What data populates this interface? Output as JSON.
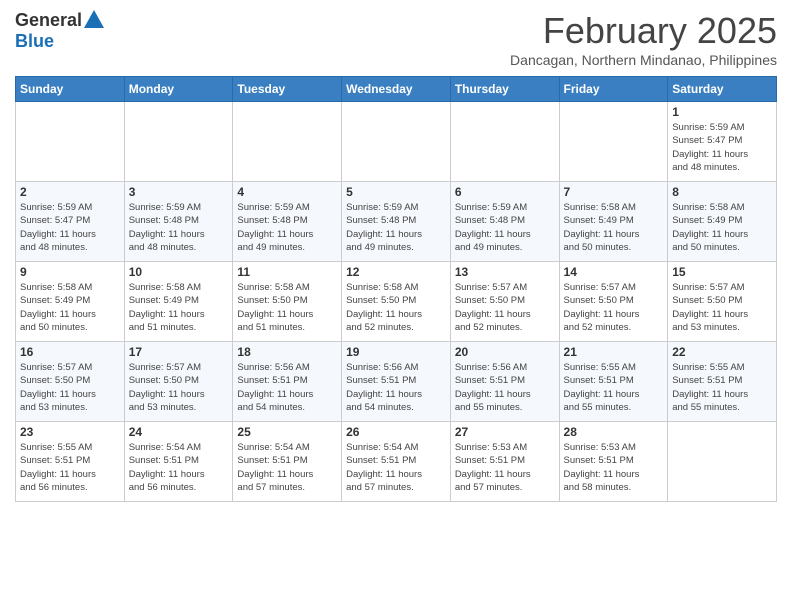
{
  "header": {
    "logo_general": "General",
    "logo_blue": "Blue",
    "month_year": "February 2025",
    "location": "Dancagan, Northern Mindanao, Philippines"
  },
  "calendar": {
    "days_of_week": [
      "Sunday",
      "Monday",
      "Tuesday",
      "Wednesday",
      "Thursday",
      "Friday",
      "Saturday"
    ],
    "weeks": [
      [
        {
          "day": "",
          "info": ""
        },
        {
          "day": "",
          "info": ""
        },
        {
          "day": "",
          "info": ""
        },
        {
          "day": "",
          "info": ""
        },
        {
          "day": "",
          "info": ""
        },
        {
          "day": "",
          "info": ""
        },
        {
          "day": "1",
          "info": "Sunrise: 5:59 AM\nSunset: 5:47 PM\nDaylight: 11 hours\nand 48 minutes."
        }
      ],
      [
        {
          "day": "2",
          "info": "Sunrise: 5:59 AM\nSunset: 5:47 PM\nDaylight: 11 hours\nand 48 minutes."
        },
        {
          "day": "3",
          "info": "Sunrise: 5:59 AM\nSunset: 5:48 PM\nDaylight: 11 hours\nand 48 minutes."
        },
        {
          "day": "4",
          "info": "Sunrise: 5:59 AM\nSunset: 5:48 PM\nDaylight: 11 hours\nand 49 minutes."
        },
        {
          "day": "5",
          "info": "Sunrise: 5:59 AM\nSunset: 5:48 PM\nDaylight: 11 hours\nand 49 minutes."
        },
        {
          "day": "6",
          "info": "Sunrise: 5:59 AM\nSunset: 5:48 PM\nDaylight: 11 hours\nand 49 minutes."
        },
        {
          "day": "7",
          "info": "Sunrise: 5:58 AM\nSunset: 5:49 PM\nDaylight: 11 hours\nand 50 minutes."
        },
        {
          "day": "8",
          "info": "Sunrise: 5:58 AM\nSunset: 5:49 PM\nDaylight: 11 hours\nand 50 minutes."
        }
      ],
      [
        {
          "day": "9",
          "info": "Sunrise: 5:58 AM\nSunset: 5:49 PM\nDaylight: 11 hours\nand 50 minutes."
        },
        {
          "day": "10",
          "info": "Sunrise: 5:58 AM\nSunset: 5:49 PM\nDaylight: 11 hours\nand 51 minutes."
        },
        {
          "day": "11",
          "info": "Sunrise: 5:58 AM\nSunset: 5:50 PM\nDaylight: 11 hours\nand 51 minutes."
        },
        {
          "day": "12",
          "info": "Sunrise: 5:58 AM\nSunset: 5:50 PM\nDaylight: 11 hours\nand 52 minutes."
        },
        {
          "day": "13",
          "info": "Sunrise: 5:57 AM\nSunset: 5:50 PM\nDaylight: 11 hours\nand 52 minutes."
        },
        {
          "day": "14",
          "info": "Sunrise: 5:57 AM\nSunset: 5:50 PM\nDaylight: 11 hours\nand 52 minutes."
        },
        {
          "day": "15",
          "info": "Sunrise: 5:57 AM\nSunset: 5:50 PM\nDaylight: 11 hours\nand 53 minutes."
        }
      ],
      [
        {
          "day": "16",
          "info": "Sunrise: 5:57 AM\nSunset: 5:50 PM\nDaylight: 11 hours\nand 53 minutes."
        },
        {
          "day": "17",
          "info": "Sunrise: 5:57 AM\nSunset: 5:50 PM\nDaylight: 11 hours\nand 53 minutes."
        },
        {
          "day": "18",
          "info": "Sunrise: 5:56 AM\nSunset: 5:51 PM\nDaylight: 11 hours\nand 54 minutes."
        },
        {
          "day": "19",
          "info": "Sunrise: 5:56 AM\nSunset: 5:51 PM\nDaylight: 11 hours\nand 54 minutes."
        },
        {
          "day": "20",
          "info": "Sunrise: 5:56 AM\nSunset: 5:51 PM\nDaylight: 11 hours\nand 55 minutes."
        },
        {
          "day": "21",
          "info": "Sunrise: 5:55 AM\nSunset: 5:51 PM\nDaylight: 11 hours\nand 55 minutes."
        },
        {
          "day": "22",
          "info": "Sunrise: 5:55 AM\nSunset: 5:51 PM\nDaylight: 11 hours\nand 55 minutes."
        }
      ],
      [
        {
          "day": "23",
          "info": "Sunrise: 5:55 AM\nSunset: 5:51 PM\nDaylight: 11 hours\nand 56 minutes."
        },
        {
          "day": "24",
          "info": "Sunrise: 5:54 AM\nSunset: 5:51 PM\nDaylight: 11 hours\nand 56 minutes."
        },
        {
          "day": "25",
          "info": "Sunrise: 5:54 AM\nSunset: 5:51 PM\nDaylight: 11 hours\nand 57 minutes."
        },
        {
          "day": "26",
          "info": "Sunrise: 5:54 AM\nSunset: 5:51 PM\nDaylight: 11 hours\nand 57 minutes."
        },
        {
          "day": "27",
          "info": "Sunrise: 5:53 AM\nSunset: 5:51 PM\nDaylight: 11 hours\nand 57 minutes."
        },
        {
          "day": "28",
          "info": "Sunrise: 5:53 AM\nSunset: 5:51 PM\nDaylight: 11 hours\nand 58 minutes."
        },
        {
          "day": "",
          "info": ""
        }
      ]
    ]
  }
}
